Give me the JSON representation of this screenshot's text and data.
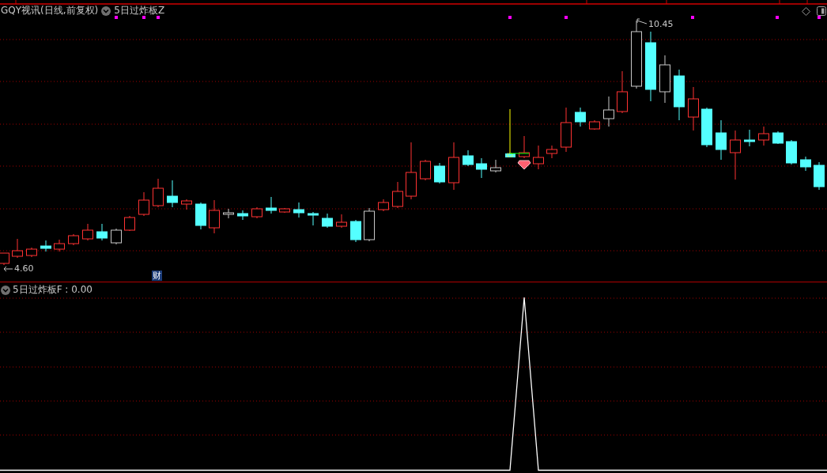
{
  "main_panel": {
    "title": "GQY视讯(日线,前复权)",
    "indicator": "5日过炸板Z",
    "high_label": "10.45",
    "low_label": "4.60",
    "marker": "财"
  },
  "lower_panel": {
    "title": "5日过炸板F : 0.00"
  }
}
